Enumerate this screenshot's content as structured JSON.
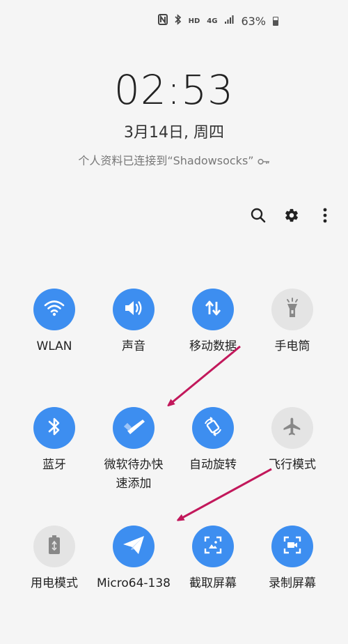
{
  "status_bar": {
    "hd": "HD",
    "network": "4G",
    "battery_percent": "63%",
    "battery_level": 0.63
  },
  "lock": {
    "time": "02:53",
    "date": "3月14日, 周四",
    "vpn_note": "个人资料已连接到“Shadowsocks”"
  },
  "toolbar": {
    "search_icon": "search-icon",
    "settings_icon": "gear-icon",
    "more_icon": "more-vert-icon"
  },
  "tiles": [
    {
      "label": "WLAN",
      "icon": "wifi-icon",
      "state": "on"
    },
    {
      "label": "声音",
      "icon": "volume-icon",
      "state": "on"
    },
    {
      "label": "移动数据",
      "icon": "data-arrows-icon",
      "state": "on"
    },
    {
      "label": "手电筒",
      "icon": "flashlight-icon",
      "state": "off"
    },
    {
      "label": "蓝牙",
      "icon": "bluetooth-icon",
      "state": "on"
    },
    {
      "label": "微软待办快速添加",
      "label_line1": "微软待办快",
      "label_line2": "速添加",
      "icon": "todo-check-icon",
      "state": "on"
    },
    {
      "label": "自动旋转",
      "icon": "rotate-icon",
      "state": "on"
    },
    {
      "label": "飞行模式",
      "icon": "airplane-icon",
      "state": "off"
    },
    {
      "label": "用电模式",
      "icon": "power-mode-icon",
      "state": "off"
    },
    {
      "label": "Micro64-138",
      "icon": "send-icon",
      "state": "on"
    },
    {
      "label": "截取屏幕",
      "icon": "screenshot-icon",
      "state": "on"
    },
    {
      "label": "录制屏幕",
      "icon": "screen-record-icon",
      "state": "on"
    }
  ],
  "colors": {
    "tile_on": "#3d8ef0",
    "tile_off": "#e4e4e4",
    "arrow": "#c2185b"
  }
}
